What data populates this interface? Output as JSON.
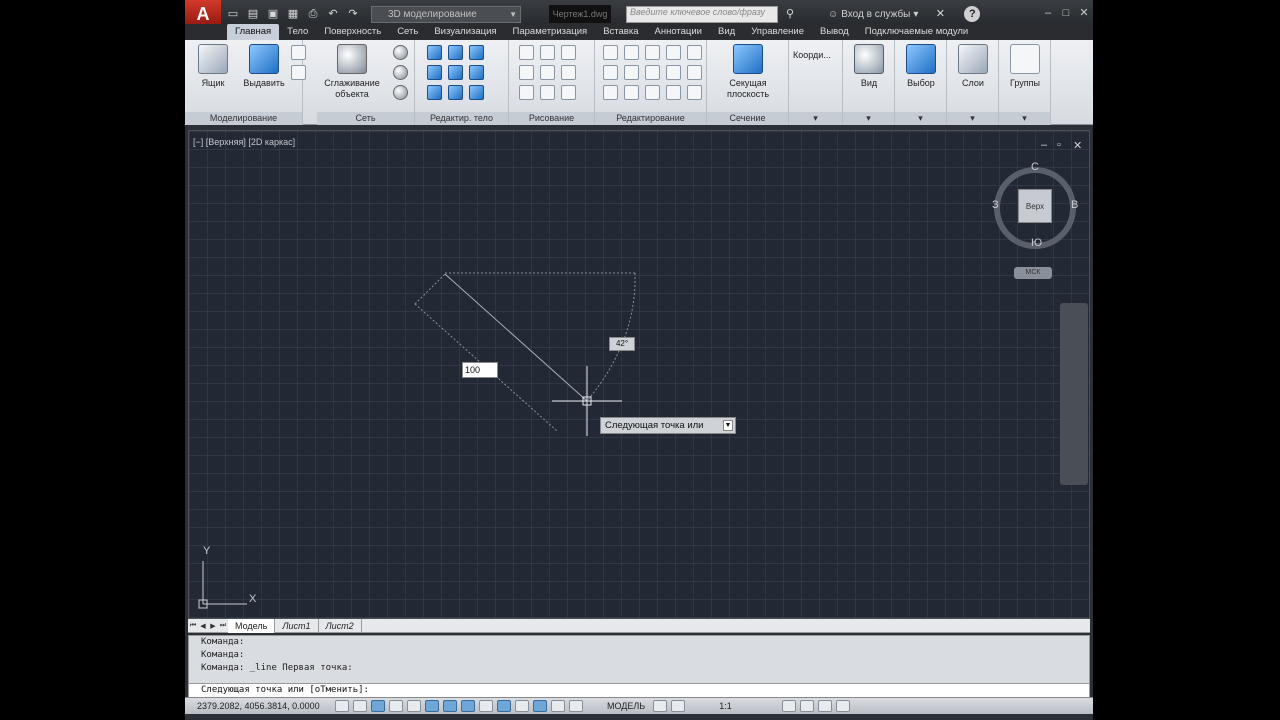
{
  "titlebar": {
    "logo": "A",
    "workspace": "3D моделирование",
    "file_title": "Чертеж1.dwg",
    "search_placeholder": "Введите ключевое слово/фразу",
    "signin": "Вход в службы"
  },
  "ribbon_tabs": [
    "Главная",
    "Тело",
    "Поверхность",
    "Сеть",
    "Визуализация",
    "Параметризация",
    "Вставка",
    "Аннотации",
    "Вид",
    "Управление",
    "Вывод",
    "Подключаемые модули"
  ],
  "ribbon": {
    "box_label": "Ящик",
    "extrude_label": "Выдавить",
    "smooth_label_1": "Сглаживание",
    "smooth_label_2": "объекта",
    "section_label_1": "Секущая",
    "section_label_2": "плоскость",
    "coords_label": "Коорди...",
    "view_label": "Вид",
    "select_label": "Выбор",
    "layers_label": "Слои",
    "groups_label": "Группы",
    "groups": {
      "modeling": "Моделирование",
      "mesh": "Сеть",
      "solid_edit": "Редактир. тело",
      "draw": "Рисование",
      "modify": "Редактирование",
      "section": "Сечение"
    }
  },
  "viewport": {
    "label": "[−] [Верхняя] [2D каркас]",
    "viewcube": {
      "n": "С",
      "s": "Ю",
      "w": "З",
      "e": "В",
      "face": "Верх"
    },
    "wcs": "МСК",
    "tooltip": "Следующая точка или",
    "dim_length": "100",
    "dim_angle": "42°",
    "ucs_x": "X",
    "ucs_y": "Y"
  },
  "layout_tabs": [
    "Модель",
    "Лист1",
    "Лист2"
  ],
  "command": {
    "history": [
      "Команда:",
      "Команда:",
      "Команда: _line Первая точка:"
    ],
    "current": "Следующая точка или [оТменить]:"
  },
  "status": {
    "coords": "2379.2082, 4056.3814, 0.0000",
    "model": "МОДЕЛЬ",
    "scale": "1:1"
  },
  "colors": {
    "accent": "#c9cfd8",
    "viewport_bg": "#222834",
    "logo": "#d23a2a"
  }
}
